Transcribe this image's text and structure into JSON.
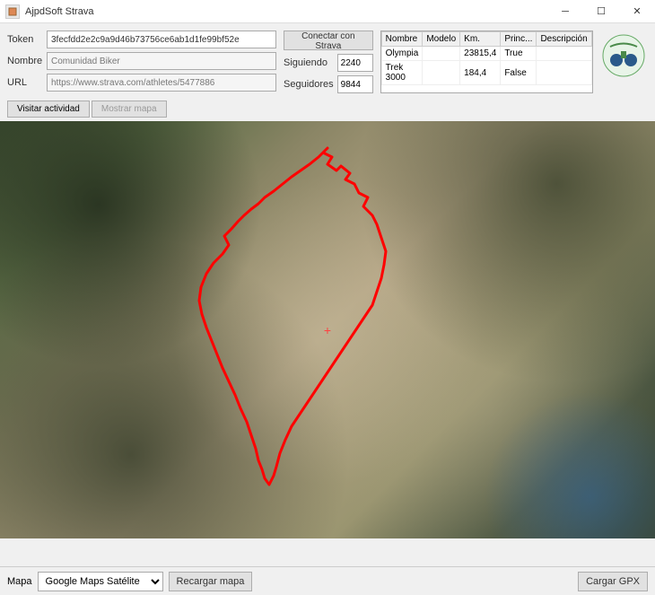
{
  "window": {
    "title": "AjpdSoft Strava"
  },
  "fields": {
    "token_label": "Token",
    "token_value": "3fecfdd2e2c9a9d46b73756ce6ab1d1fe99bf52e",
    "nombre_label": "Nombre",
    "nombre_value": "Comunidad Biker",
    "url_label": "URL",
    "url_value": "https://www.strava.com/athletes/5477886",
    "connect_btn": "Conectar con Strava",
    "siguiendo_label": "Siguiendo",
    "siguiendo_value": "2240",
    "seguidores_label": "Seguidores",
    "seguidores_value": "9844"
  },
  "grid": {
    "headers": {
      "nombre": "Nombre",
      "modelo": "Modelo",
      "km": "Km.",
      "princ": "Princ...",
      "descripcion": "Descripción"
    },
    "rows": [
      {
        "nombre": "Olympia",
        "modelo": "",
        "km": "23815,4",
        "princ": "True",
        "descripcion": ""
      },
      {
        "nombre": "Trek 3000",
        "modelo": "",
        "km": "184,4",
        "princ": "False",
        "descripcion": ""
      }
    ]
  },
  "tabs": {
    "visitar": "Visitar actividad",
    "mostrar": "Mostrar mapa"
  },
  "bottom": {
    "mapa_label": "Mapa",
    "map_type": "Google Maps Satélite",
    "recargar": "Recargar mapa",
    "cargar_gpx": "Cargar GPX"
  }
}
